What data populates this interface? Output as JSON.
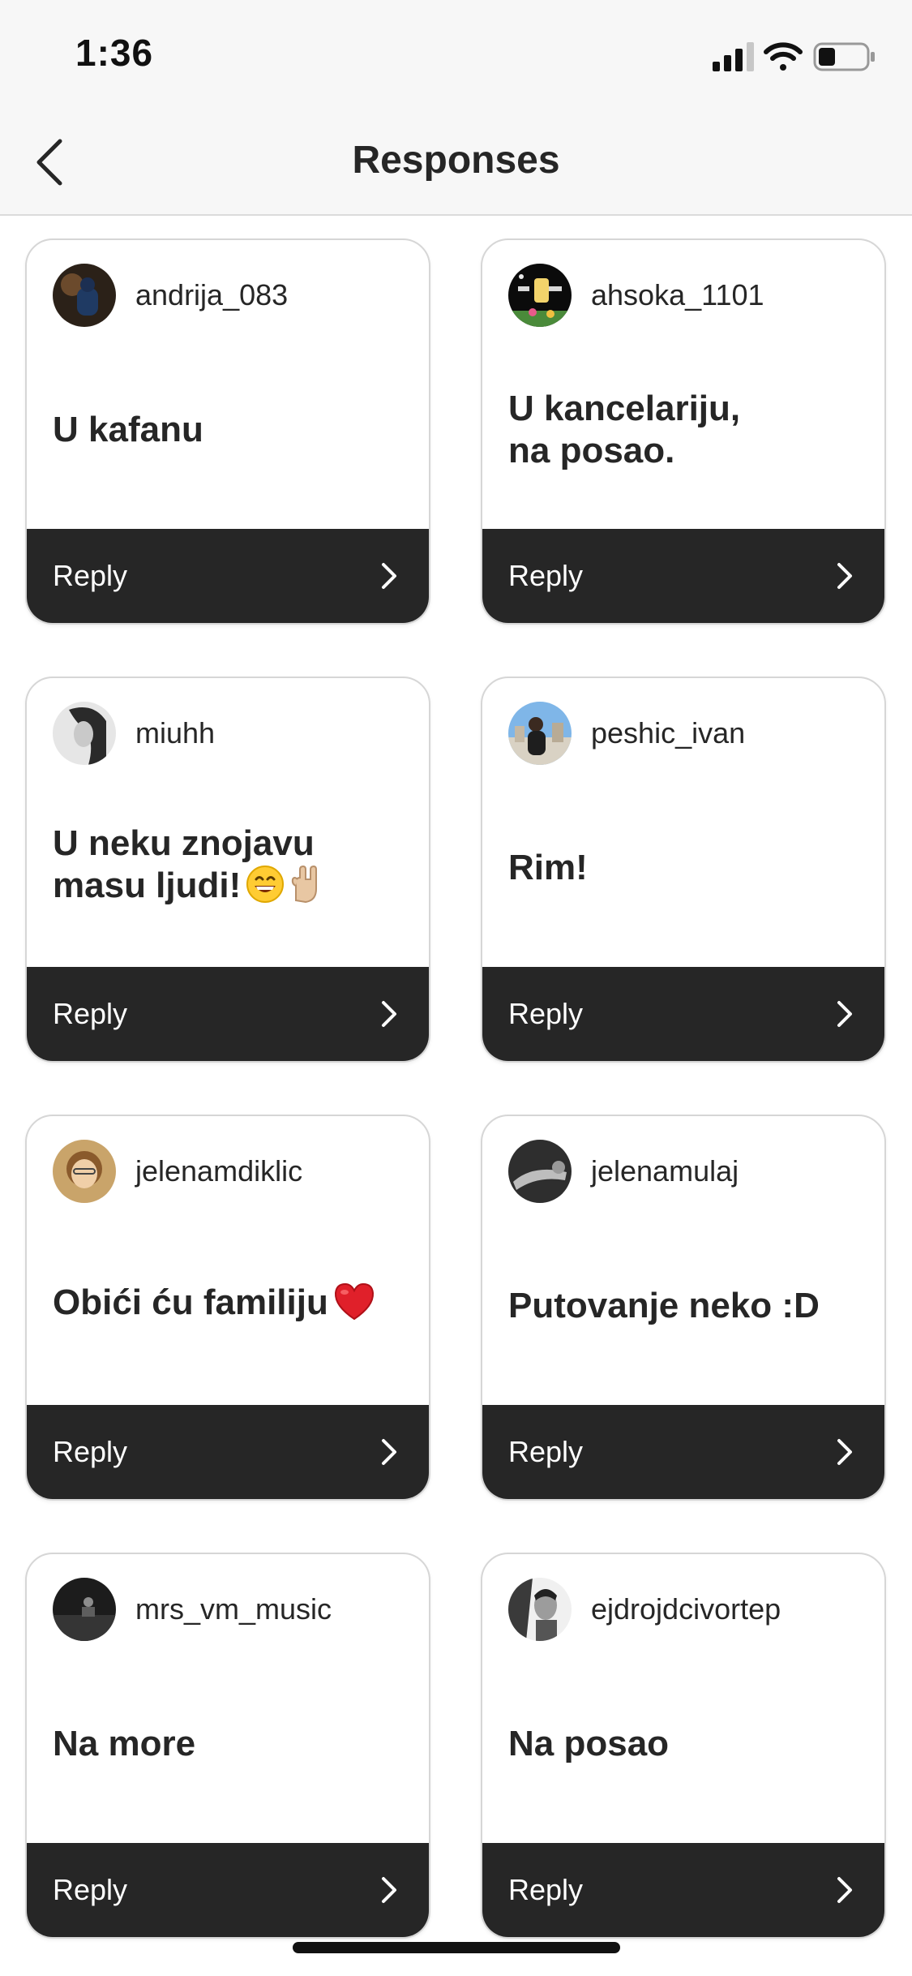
{
  "status_bar": {
    "time": "1:36"
  },
  "nav": {
    "title": "Responses"
  },
  "reply_label": "Reply",
  "responses": [
    {
      "username": "andrija_083",
      "text": "U kafanu"
    },
    {
      "username": "ahsoka_1101",
      "text": "U kancelariju,\nna posao."
    },
    {
      "username": "miuhh",
      "text": "U neku znojavu\nmasu ljudi!"
    },
    {
      "username": "peshic_ivan",
      "text": "Rim!"
    },
    {
      "username": "jelenamdiklic",
      "text": "Obići ću familiju"
    },
    {
      "username": "jelenamulaj",
      "text": "Putovanje neko :D"
    },
    {
      "username": "mrs_vm_music",
      "text": "Na more"
    },
    {
      "username": "ejdrojdcivortep",
      "text": "Na posao"
    }
  ]
}
